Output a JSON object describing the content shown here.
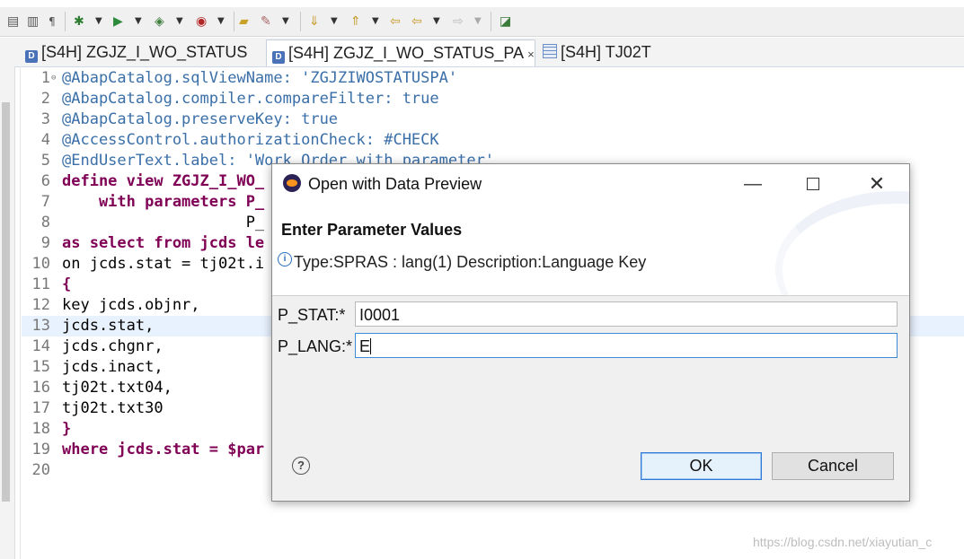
{
  "toolbar": {
    "icons": [
      "save-all-icon",
      "paste-icon",
      "pilcrow-icon",
      "debug-icon",
      "run-icon",
      "run-config-icon",
      "external-tool-icon",
      "open-folder-icon",
      "pen-icon",
      "next-annotation-icon",
      "prev-annotation-icon",
      "back-icon",
      "forward-icon",
      "pin-icon"
    ]
  },
  "tabs": [
    {
      "label": "[S4H] ZGJZ_I_WO_STATUS",
      "icon": "ddl-source-icon",
      "active": false
    },
    {
      "label": "[S4H] ZGJZ_I_WO_STATUS_PA",
      "icon": "ddl-source-icon",
      "active": true,
      "close": "×"
    },
    {
      "label": "[S4H] TJ02T",
      "icon": "table-icon",
      "active": false
    }
  ],
  "editor": {
    "lines": [
      {
        "n": "1",
        "text": "@AbapCatalog.sqlViewName: 'ZGJZIWOSTATUSPA'"
      },
      {
        "n": "2",
        "text": "@AbapCatalog.compiler.compareFilter: true"
      },
      {
        "n": "3",
        "text": "@AbapCatalog.preserveKey: true"
      },
      {
        "n": "4",
        "text": "@AccessControl.authorizationCheck: #CHECK"
      },
      {
        "n": "5",
        "text": "@EndUserText.label: 'Work Order with parameter'"
      },
      {
        "n": "6",
        "text": "define view ZGJZ_I_WO_"
      },
      {
        "n": "7",
        "text": "    with parameters P_"
      },
      {
        "n": "8",
        "text": "                    P_"
      },
      {
        "n": "9",
        "text": "as select from jcds le"
      },
      {
        "n": "10",
        "text": "on jcds.stat = tj02t.i"
      },
      {
        "n": "11",
        "text": "{"
      },
      {
        "n": "12",
        "text": "key jcds.objnr,"
      },
      {
        "n": "13",
        "text": "jcds.stat,"
      },
      {
        "n": "14",
        "text": "jcds.chgnr,"
      },
      {
        "n": "15",
        "text": "jcds.inact,"
      },
      {
        "n": "16",
        "text": "tj02t.txt04,"
      },
      {
        "n": "17",
        "text": "tj02t.txt30"
      },
      {
        "n": "18",
        "text": "}"
      },
      {
        "n": "19",
        "text": "where jcds.stat = $par"
      },
      {
        "n": "20",
        "text": ""
      }
    ],
    "fold_marker": "⊖"
  },
  "dialog": {
    "title": "Open with Data Preview",
    "heading": "Enter Parameter Values",
    "info": "Type:SPRAS : lang(1) Description:Language Key",
    "params": [
      {
        "label": "P_STAT:*",
        "value": "I0001"
      },
      {
        "label": "P_LANG:*",
        "value": "E"
      }
    ],
    "help": "?",
    "ok_label": "OK",
    "cancel_label": "Cancel",
    "min": "—",
    "close": "✕"
  },
  "watermark": "https://blog.csdn.net/xiayutian_c",
  "colors": {
    "keyword": "#7f0055",
    "annotation": "#3a6fa8",
    "string": "#2a3fd6",
    "focus": "#3c8ad8"
  }
}
